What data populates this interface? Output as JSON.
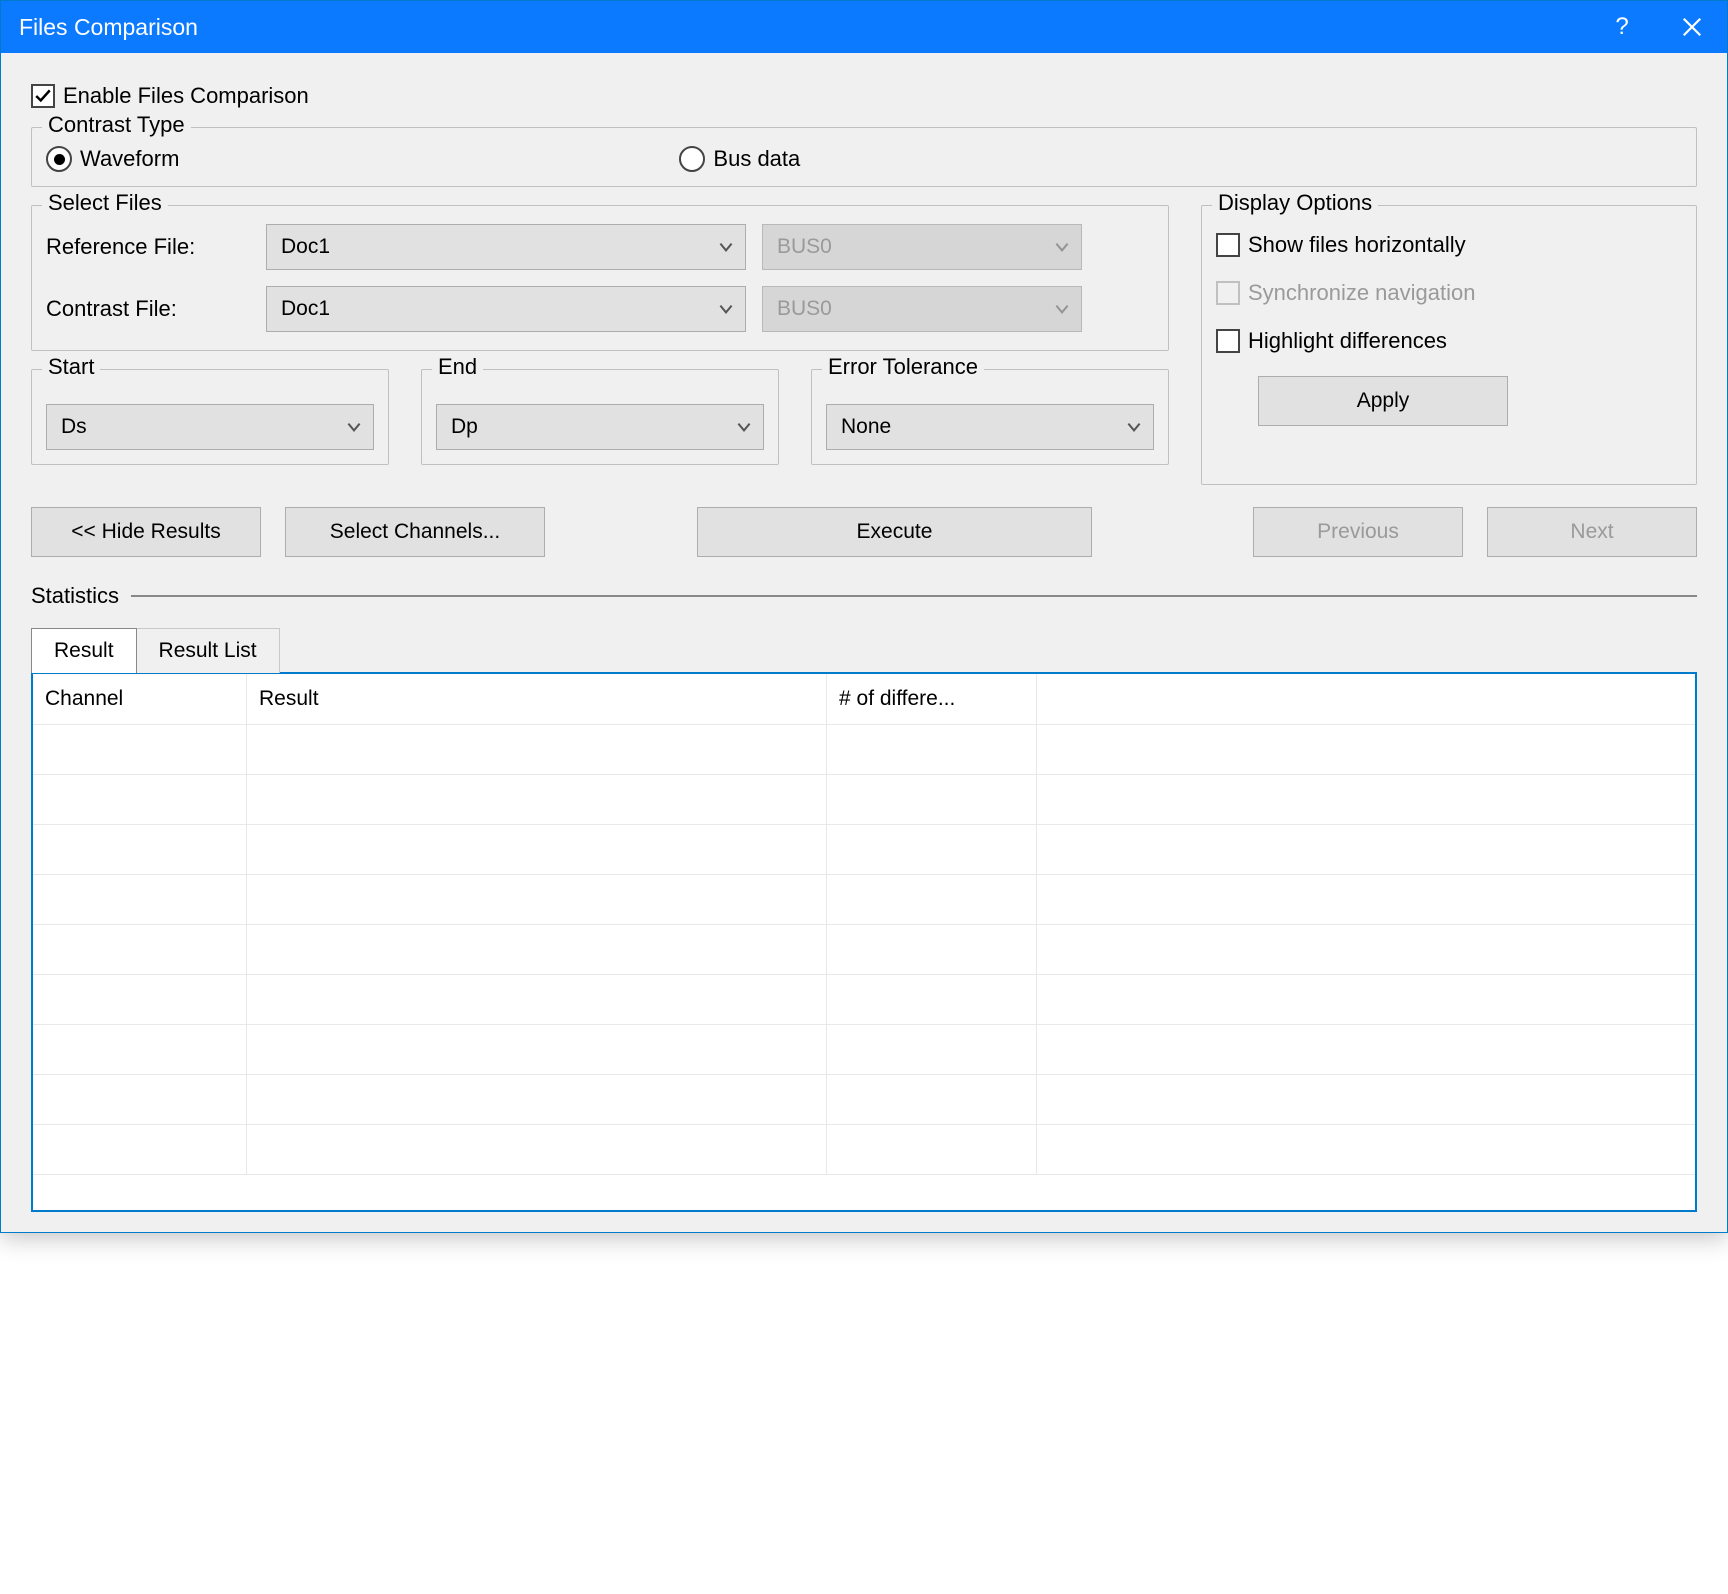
{
  "title": "Files Comparison",
  "enable_label": "Enable Files Comparison",
  "enable_checked": true,
  "contrast_type": {
    "legend": "Contrast Type",
    "waveform": "Waveform",
    "busdata": "Bus data",
    "selected": "waveform"
  },
  "select_files": {
    "legend": "Select Files",
    "reference_label": "Reference File:",
    "contrast_label": "Contrast File:",
    "reference_file": "Doc1",
    "reference_bus": "BUS0",
    "contrast_file": "Doc1",
    "contrast_bus": "BUS0"
  },
  "start": {
    "legend": "Start",
    "value": "Ds"
  },
  "end": {
    "legend": "End",
    "value": "Dp"
  },
  "error_tol": {
    "legend": "Error Tolerance",
    "value": "None"
  },
  "display": {
    "legend": "Display Options",
    "show_horiz": "Show files horizontally",
    "sync_nav": "Synchronize navigation",
    "highlight": "Highlight differences",
    "apply": "Apply"
  },
  "buttons": {
    "hide": "<< Hide Results",
    "select_channels": "Select Channels...",
    "execute": "Execute",
    "previous": "Previous",
    "next": "Next"
  },
  "statistics": {
    "label": "Statistics",
    "tabs": {
      "result": "Result",
      "result_list": "Result List"
    },
    "columns": {
      "channel": "Channel",
      "result": "Result",
      "ndiff": "# of differe..."
    }
  }
}
